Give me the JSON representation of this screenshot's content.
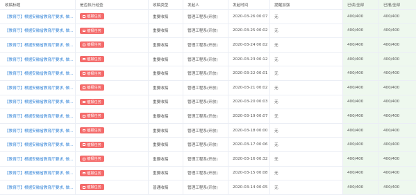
{
  "headers": [
    "收稿标题",
    "是否执行经查",
    "收稿类型",
    "发起人",
    "发起时间",
    "提醒加强",
    "已读/全部",
    "已报/全部"
  ],
  "rows": [
    {
      "title": "【教育厅】根据安徽省教育厅要求, 做...",
      "action": "催报任务",
      "type": "重要收稿",
      "sender": "管理工程系(开放)",
      "time": "2020-03-26 00:07",
      "remind": "无",
      "read": "400/400",
      "reported": "400/400"
    },
    {
      "title": "【教育厅】根据安徽省教育厅要求, 做...",
      "action": "催报任务",
      "type": "重要收稿",
      "sender": "管理工程系(开放)",
      "time": "2020-03-25 00:02",
      "remind": "无",
      "read": "400/400",
      "reported": "400/400"
    },
    {
      "title": "【教育厅】根据安徽省教育厅要求, 做...",
      "action": "催报任务",
      "type": "重要收稿",
      "sender": "管理工程系(开放)",
      "time": "2020-03-24 00:02",
      "remind": "无",
      "read": "400/400",
      "reported": "400/400"
    },
    {
      "title": "【教育厅】根据安徽省教育厅要求, 做...",
      "action": "催报任务",
      "type": "重要收稿",
      "sender": "管理工程系(开放)",
      "time": "2020-03-23 00:12",
      "remind": "无",
      "read": "400/400",
      "reported": "400/400"
    },
    {
      "title": "【教育厅】根据安徽省教育厅要求, 做...",
      "action": "催报任务",
      "type": "重要收稿",
      "sender": "管理工程系(开放)",
      "time": "2020-03-22 00:01",
      "remind": "无",
      "read": "400/400",
      "reported": "400/400"
    },
    {
      "title": "【教育厅】根据安徽省教育厅要求, 做...",
      "action": "催报任务",
      "type": "重要收稿",
      "sender": "管理工程系(开放)",
      "time": "2020-03-21 00:02",
      "remind": "无",
      "read": "400/400",
      "reported": "400/400"
    },
    {
      "title": "【教育厅】根据安徽省教育厅要求, 做...",
      "action": "催报任务",
      "type": "重要收稿",
      "sender": "管理工程系(开放)",
      "time": "2020-03-20 00:03",
      "remind": "无",
      "read": "400/400",
      "reported": "400/400"
    },
    {
      "title": "【教育厅】根据安徽省教育厅要求, 做...",
      "action": "催报任务",
      "type": "重要收稿",
      "sender": "管理工程系(开放)",
      "time": "2020-03-19 00:07",
      "remind": "无",
      "read": "400/400",
      "reported": "400/400"
    },
    {
      "title": "【教育厅】根据安徽省教育厅要求, 做...",
      "action": "催报任务",
      "type": "重要收稿",
      "sender": "管理工程系(开放)",
      "time": "2020-03-18 00:00",
      "remind": "无",
      "read": "400/400",
      "reported": "400/400"
    },
    {
      "title": "【教育厅】根据安徽省教育厅要求, 做...",
      "action": "催报任务",
      "type": "重要收稿",
      "sender": "管理工程系(开放)",
      "time": "2020-03-17 00:06",
      "remind": "无",
      "read": "400/400",
      "reported": "400/400"
    },
    {
      "title": "【教育厅】根据安徽省教育厅要求, 做...",
      "action": "催报任务",
      "type": "重要收稿",
      "sender": "管理工程系(开放)",
      "time": "2020-03-16 00:32",
      "remind": "无",
      "read": "400/400",
      "reported": "400/400"
    },
    {
      "title": "【教育厅】根据安徽省教育厅要求, 做...",
      "action": "催报任务",
      "type": "重要收稿",
      "sender": "管理工程系(开放)",
      "time": "2020-03-15 00:08",
      "remind": "无",
      "read": "400/400",
      "reported": "400/400"
    },
    {
      "title": "【教育厅】根据安徽省教育厅要求, 做...",
      "action": "催报任务",
      "type": "普通收稿",
      "sender": "管理工程系(开放)",
      "time": "2020-03-14 00:05",
      "remind": "无",
      "read": "400/400",
      "reported": "400/400"
    }
  ]
}
